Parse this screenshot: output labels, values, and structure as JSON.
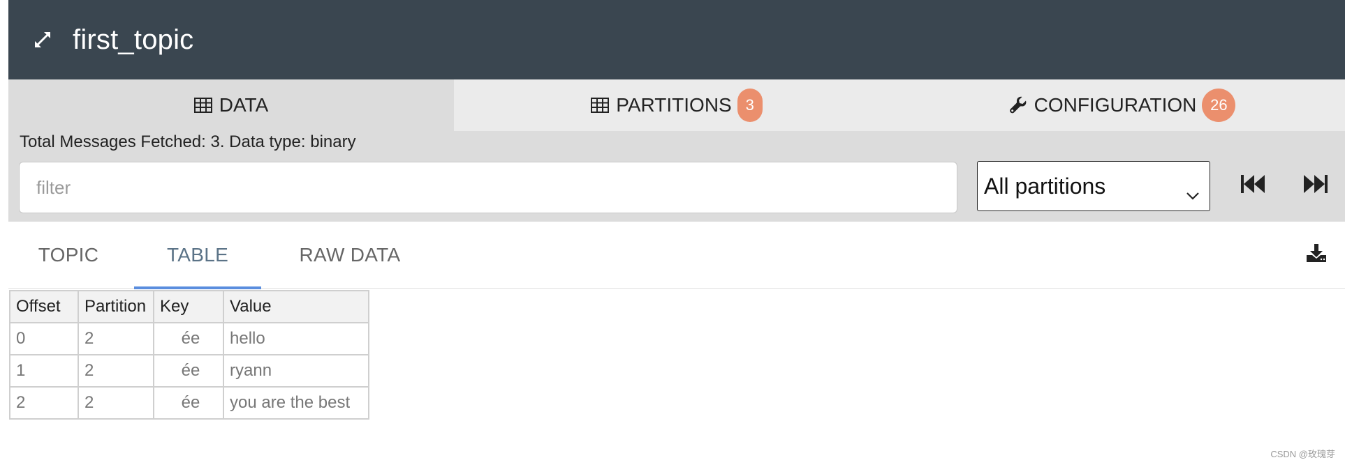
{
  "header": {
    "title": "first_topic",
    "expand_icon": "expand-icon",
    "background": "#3a4650"
  },
  "top_tabs": [
    {
      "label": "DATA",
      "icon": "table-icon",
      "badge": null,
      "active": true
    },
    {
      "label": "PARTITIONS",
      "icon": "table-icon",
      "badge": "3",
      "active": false
    },
    {
      "label": "CONFIGURATION",
      "icon": "wrench-icon",
      "badge": "26",
      "active": false
    }
  ],
  "summary": "Total Messages Fetched: 3. Data type: binary",
  "filter": {
    "value": "",
    "placeholder": "filter"
  },
  "partition_select": {
    "selected": "All partitions"
  },
  "nav": {
    "first_icon": "skip-to-start-icon",
    "last_icon": "skip-to-end-icon"
  },
  "sub_tabs": [
    {
      "label": "TOPIC",
      "active": false
    },
    {
      "label": "TABLE",
      "active": true
    },
    {
      "label": "RAW DATA",
      "active": false
    }
  ],
  "download_icon": "download-icon",
  "table": {
    "columns": [
      "Offset",
      "Partition",
      "Key",
      "Value"
    ],
    "rows": [
      [
        "0",
        "2",
        "ée",
        "hello"
      ],
      [
        "1",
        "2",
        "ée",
        "ryann"
      ],
      [
        "2",
        "2",
        "ée",
        "you are the best"
      ]
    ]
  },
  "watermark": "CSDN @玫瑰芽",
  "colors": {
    "header_bg": "#3a4650",
    "badge_bg": "#eb8f6d",
    "active_tab_underline": "#5a8dde",
    "active_subtab_text": "#5b7387"
  }
}
